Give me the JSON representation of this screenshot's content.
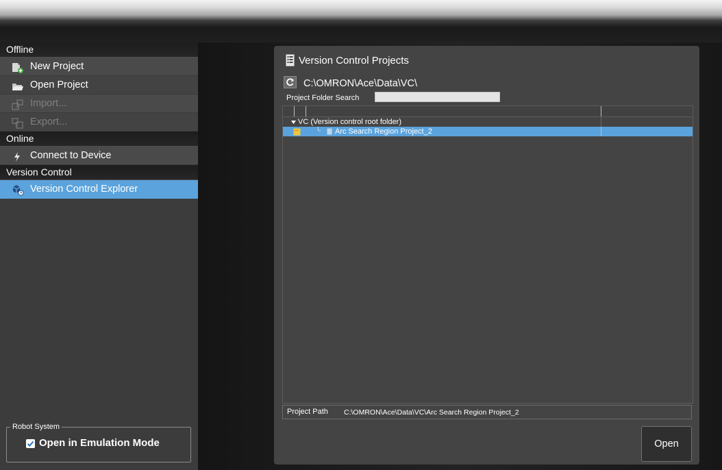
{
  "sidebar": {
    "sections": {
      "offline": "Offline",
      "online": "Online",
      "version_control": "Version Control"
    },
    "items": {
      "new_project": "New Project",
      "open_project": "Open Project",
      "import": "Import...",
      "export": "Export...",
      "connect_to_device": "Connect to Device",
      "version_control_explorer": "Version Control Explorer"
    },
    "robot_system": {
      "legend": "Robot System",
      "emulation_label": "Open in Emulation Mode",
      "emulation_checked": true
    }
  },
  "panel": {
    "title": "Version Control Projects",
    "vc_path": "C:\\OMRON\\Ace\\Data\\VC\\",
    "folder_search_label": "Project Folder Search",
    "folder_search_value": "",
    "tree": {
      "root_label": "VC (Version control root folder)",
      "child_label": "Arc Search Region Project_2"
    },
    "project_path_label": "Project Path",
    "project_path_value": "C:\\OMRON\\Ace\\Data\\VC\\Arc Search Region Project_2",
    "open_button": "Open"
  },
  "colors": {
    "selection": "#5ba3dc",
    "panel_bg": "#444444",
    "sidebar_bg": "#3c3c3c"
  },
  "icons": {
    "new_project": "new-project-icon",
    "open_project": "folder-open-icon",
    "import": "import-icon",
    "export": "export-icon",
    "connect": "lightning-icon",
    "explorer": "version-control-icon",
    "panel_title": "document-list-icon",
    "refresh": "refresh-icon",
    "tree_folder": "folder-icon",
    "tree_project": "project-file-icon",
    "emulation_check": "checkbox-checked-icon"
  }
}
